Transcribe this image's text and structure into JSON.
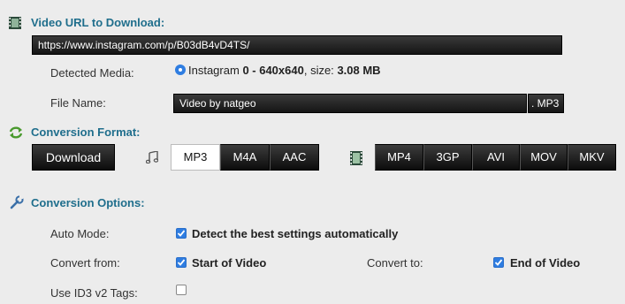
{
  "video_url": {
    "title": "Video URL to Download:",
    "value": "https://www.instagram.com/p/B03dB4vD4TS/"
  },
  "detected_media": {
    "label": "Detected Media:",
    "source": "Instagram",
    "resolution": "0 - 640x640",
    "size_prefix": ", size:",
    "size": "3.08 MB"
  },
  "file_name": {
    "label": "File Name:",
    "value": "Video by natgeo",
    "extension": ". MP3"
  },
  "conversion_format": {
    "title": "Conversion Format:",
    "download_label": "Download",
    "audio_formats": [
      "MP3",
      "M4A",
      "AAC"
    ],
    "selected_audio": "MP3",
    "video_formats": [
      "MP4",
      "3GP",
      "AVI",
      "MOV",
      "MKV"
    ]
  },
  "conversion_options": {
    "title": "Conversion Options:",
    "auto_mode_label": "Auto Mode:",
    "auto_mode_text": "Detect the best settings automatically",
    "auto_mode_checked": true,
    "convert_from_label": "Convert from:",
    "convert_from_text": "Start of Video",
    "convert_from_checked": true,
    "convert_to_label": "Convert to:",
    "convert_to_text": "End of Video",
    "convert_to_checked": true,
    "id3_label": "Use ID3 v2 Tags:",
    "id3_checked": false
  },
  "colors": {
    "section_title": "#1f6e8c",
    "checkbox_on": "#2f7de1",
    "radio_on": "#2f7de1"
  }
}
